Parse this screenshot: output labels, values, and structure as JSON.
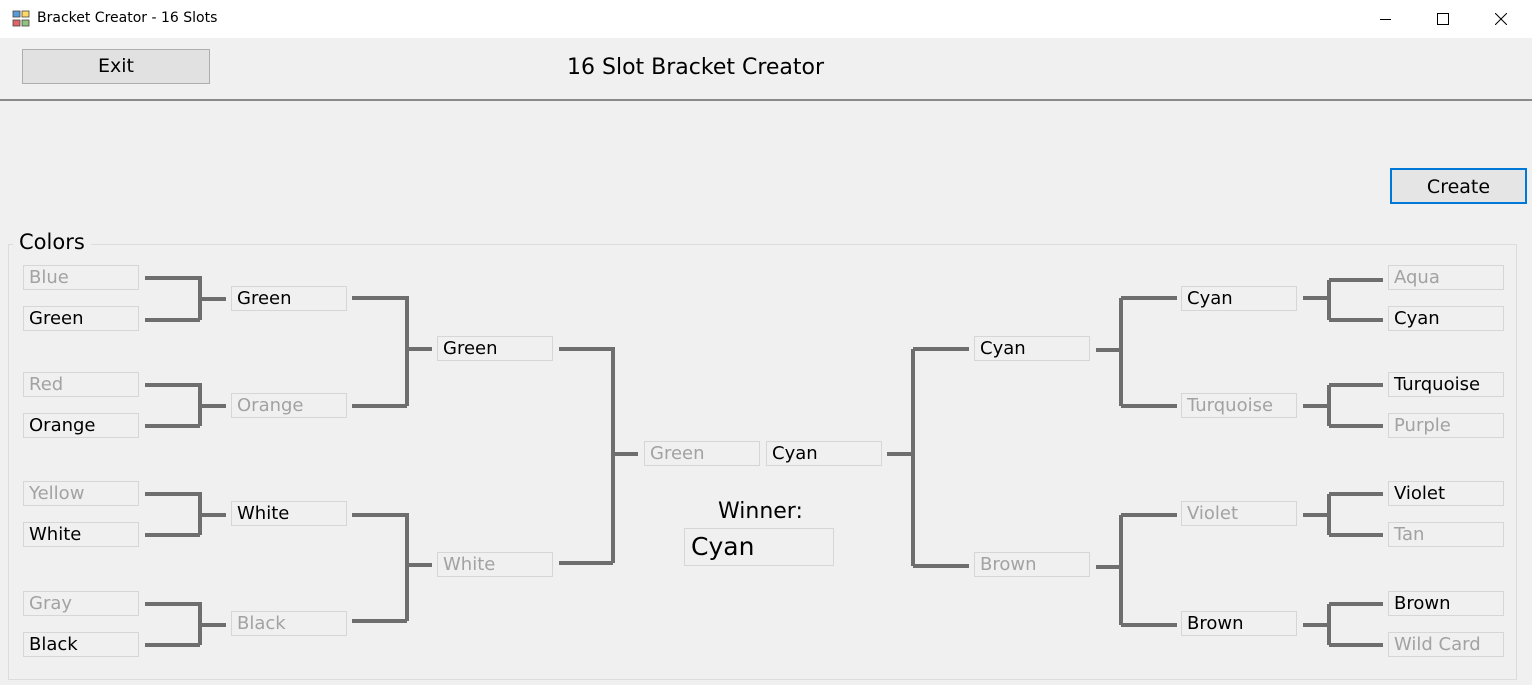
{
  "window": {
    "title": "Bracket Creator - 16 Slots"
  },
  "header": {
    "exit_label": "Exit",
    "title": "16 Slot Bracket Creator"
  },
  "create_label": "Create",
  "group_label": "Colors",
  "bracket": {
    "left_round1": [
      "Blue",
      "Green",
      "Red",
      "Orange",
      "Yellow",
      "White",
      "Gray",
      "Black"
    ],
    "left_round2": [
      "Green",
      "Orange",
      "White",
      "Black"
    ],
    "left_round3": [
      "Green",
      "White"
    ],
    "left_final": "Green",
    "right_final": "Cyan",
    "right_round3": [
      "Cyan",
      "Brown"
    ],
    "right_round2": [
      "Cyan",
      "Turquoise",
      "Violet",
      "Brown"
    ],
    "right_round1": [
      "Aqua",
      "Cyan",
      "Turquoise",
      "Purple",
      "Violet",
      "Tan",
      "Brown",
      "Wild Card"
    ]
  },
  "winner": {
    "label": "Winner:",
    "value": "Cyan"
  },
  "colors": {
    "connector": "#6e6e6e",
    "active_text": "#000000",
    "eliminated_text": "#a2a2a2",
    "focus_border": "#0078d7"
  }
}
